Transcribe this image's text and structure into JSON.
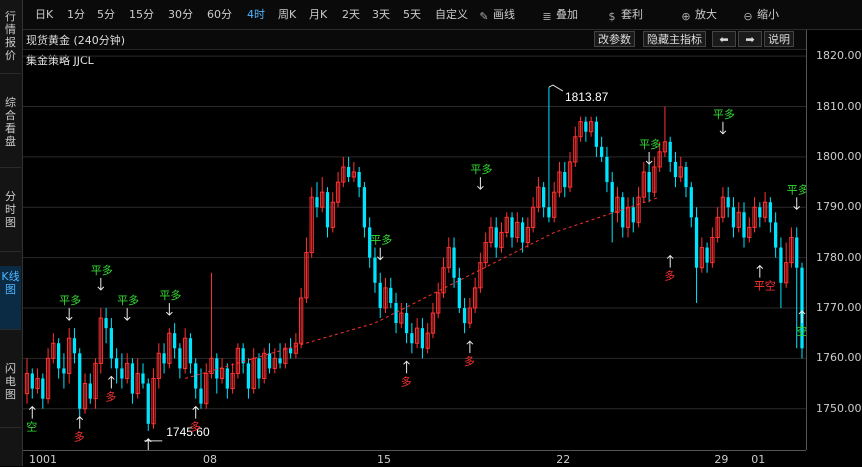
{
  "left_tabs": [
    {
      "label": "行情报价",
      "active": false
    },
    {
      "label": "综合看盘",
      "active": false
    },
    {
      "label": "分时图",
      "active": false
    },
    {
      "label": "K线图",
      "active": true
    },
    {
      "label": "闪电图",
      "active": false
    }
  ],
  "toolbar": {
    "periods": [
      "日K",
      "1分",
      "5分",
      "15分",
      "30分",
      "60分",
      "4时",
      "周K",
      "月K",
      "2天",
      "3天",
      "5天",
      "自定义"
    ],
    "active_period": "4时",
    "tools": [
      {
        "label": "画线",
        "icon": "pencil-icon"
      },
      {
        "label": "叠加",
        "icon": "stack-icon"
      },
      {
        "label": "套利",
        "icon": "money-bag-icon"
      },
      {
        "label": "放大",
        "icon": "zoom-in-icon"
      },
      {
        "label": "缩小",
        "icon": "zoom-out-icon"
      }
    ]
  },
  "chart_header": {
    "title": "现货黄金 (240分钟)",
    "params_button": "改参数",
    "hide_indicator_button": "隐藏主指标",
    "left_arrow": "⬅",
    "right_arrow": "➡",
    "explain_button": "说明"
  },
  "strategy_label": "集金策略 JJCL",
  "price_axis": [
    "1820.00",
    "1810.00",
    "1800.00",
    "1790.00",
    "1780.00",
    "1770.00",
    "1760.00",
    "1750.00"
  ],
  "date_axis": [
    "1001",
    "08",
    "15",
    "22",
    "29",
    "01"
  ],
  "annotations": {
    "high": "1813.87",
    "low": "1745.60"
  },
  "signals": {
    "flat_long": "平多",
    "long": "多",
    "short": "空",
    "flat_short": "平空"
  },
  "colors": {
    "up": "#ff3232",
    "down": "#00e5ff",
    "flat_long": "#33dd33",
    "long_short": "#ff3232",
    "background": "#000000"
  },
  "chart_data": {
    "type": "candlestick",
    "symbol": "现货黄金",
    "period": "240分钟",
    "ylim": [
      1742,
      1825
    ],
    "high": 1813.87,
    "low": 1745.6,
    "candles": [
      [
        1753,
        1757,
        1760,
        1751
      ],
      [
        1757,
        1754,
        1758,
        1752
      ],
      [
        1754,
        1756,
        1758,
        1753
      ],
      [
        1756,
        1752,
        1757,
        1750
      ],
      [
        1752,
        1760,
        1762,
        1751
      ],
      [
        1760,
        1763,
        1765,
        1759
      ],
      [
        1763,
        1758,
        1764,
        1756
      ],
      [
        1758,
        1757,
        1761,
        1754
      ],
      [
        1757,
        1764,
        1766,
        1755
      ],
      [
        1764,
        1761,
        1766,
        1759
      ],
      [
        1761,
        1750,
        1762,
        1748
      ],
      [
        1750,
        1755,
        1757,
        1749
      ],
      [
        1755,
        1752,
        1757,
        1751
      ],
      [
        1752,
        1759,
        1760,
        1750
      ],
      [
        1759,
        1768,
        1770,
        1757
      ],
      [
        1768,
        1766,
        1770,
        1763
      ],
      [
        1766,
        1760,
        1768,
        1758
      ],
      [
        1760,
        1758,
        1762,
        1755
      ],
      [
        1758,
        1756,
        1761,
        1754
      ],
      [
        1756,
        1759,
        1761,
        1755
      ],
      [
        1759,
        1753,
        1760,
        1751
      ],
      [
        1753,
        1757,
        1760,
        1752
      ],
      [
        1757,
        1755,
        1759,
        1754
      ],
      [
        1755,
        1747,
        1756,
        1745.6
      ],
      [
        1747,
        1756,
        1758,
        1746
      ],
      [
        1756,
        1761,
        1763,
        1754
      ],
      [
        1761,
        1759,
        1763,
        1757
      ],
      [
        1759,
        1765,
        1766,
        1758
      ],
      [
        1765,
        1762,
        1767,
        1760
      ],
      [
        1762,
        1758,
        1763,
        1756
      ],
      [
        1758,
        1764,
        1766,
        1757
      ],
      [
        1764,
        1759,
        1765,
        1757
      ],
      [
        1759,
        1754,
        1760,
        1752
      ],
      [
        1754,
        1751,
        1758,
        1750
      ],
      [
        1751,
        1757,
        1759,
        1750
      ],
      [
        1757,
        1760,
        1777,
        1756
      ],
      [
        1760,
        1756,
        1761,
        1753
      ],
      [
        1756,
        1758,
        1760,
        1755
      ],
      [
        1758,
        1754,
        1759,
        1752
      ],
      [
        1754,
        1757,
        1759,
        1753
      ],
      [
        1757,
        1762,
        1763,
        1756
      ],
      [
        1762,
        1759,
        1763,
        1757
      ],
      [
        1759,
        1754,
        1760,
        1752
      ],
      [
        1754,
        1760,
        1762,
        1753
      ],
      [
        1760,
        1756,
        1761,
        1754
      ],
      [
        1756,
        1761,
        1762,
        1755
      ],
      [
        1761,
        1758,
        1763,
        1757
      ],
      [
        1758,
        1760,
        1762,
        1757
      ],
      [
        1760,
        1759,
        1763,
        1758
      ],
      [
        1759,
        1762,
        1763,
        1758
      ],
      [
        1762,
        1761,
        1764,
        1760
      ],
      [
        1761,
        1763,
        1765,
        1760
      ],
      [
        1763,
        1772,
        1774,
        1762
      ],
      [
        1772,
        1781,
        1784,
        1771
      ],
      [
        1781,
        1792,
        1794,
        1780
      ],
      [
        1792,
        1790,
        1795,
        1788
      ],
      [
        1790,
        1793,
        1796,
        1789
      ],
      [
        1793,
        1786,
        1794,
        1784
      ],
      [
        1786,
        1791,
        1793,
        1785
      ],
      [
        1791,
        1795,
        1797,
        1790
      ],
      [
        1795,
        1798,
        1800,
        1794
      ],
      [
        1798,
        1796,
        1800,
        1795
      ],
      [
        1796,
        1797,
        1799,
        1795
      ],
      [
        1797,
        1794,
        1798,
        1792
      ],
      [
        1794,
        1786,
        1795,
        1784
      ],
      [
        1786,
        1780,
        1788,
        1778
      ],
      [
        1780,
        1775,
        1782,
        1773
      ],
      [
        1775,
        1770,
        1777,
        1768
      ],
      [
        1770,
        1774,
        1776,
        1769
      ],
      [
        1774,
        1771,
        1776,
        1770
      ],
      [
        1771,
        1767,
        1773,
        1765
      ],
      [
        1767,
        1769,
        1771,
        1766
      ],
      [
        1769,
        1765,
        1771,
        1763
      ],
      [
        1765,
        1763,
        1767,
        1761
      ],
      [
        1763,
        1766,
        1768,
        1762
      ],
      [
        1766,
        1762,
        1768,
        1760
      ],
      [
        1762,
        1765,
        1767,
        1761
      ],
      [
        1765,
        1769,
        1771,
        1764
      ],
      [
        1769,
        1773,
        1775,
        1768
      ],
      [
        1773,
        1778,
        1780,
        1772
      ],
      [
        1778,
        1782,
        1784,
        1777
      ],
      [
        1782,
        1776,
        1784,
        1774
      ],
      [
        1776,
        1770,
        1778,
        1769
      ],
      [
        1770,
        1767,
        1772,
        1765
      ],
      [
        1767,
        1770,
        1772,
        1766
      ],
      [
        1770,
        1774,
        1776,
        1769
      ],
      [
        1774,
        1779,
        1781,
        1773
      ],
      [
        1779,
        1783,
        1785,
        1778
      ],
      [
        1783,
        1786,
        1788,
        1782
      ],
      [
        1786,
        1782,
        1788,
        1780
      ],
      [
        1782,
        1785,
        1787,
        1781
      ],
      [
        1785,
        1788,
        1789,
        1784
      ],
      [
        1788,
        1784,
        1789,
        1782
      ],
      [
        1784,
        1787,
        1789,
        1783
      ],
      [
        1787,
        1783,
        1788,
        1781
      ],
      [
        1783,
        1786,
        1788,
        1782
      ],
      [
        1786,
        1790,
        1792,
        1785
      ],
      [
        1790,
        1794,
        1796,
        1789
      ],
      [
        1794,
        1790,
        1795,
        1788
      ],
      [
        1790,
        1788,
        1813.87,
        1787
      ],
      [
        1788,
        1793,
        1795,
        1787
      ],
      [
        1793,
        1797,
        1799,
        1792
      ],
      [
        1797,
        1794,
        1799,
        1792
      ],
      [
        1794,
        1799,
        1801,
        1793
      ],
      [
        1799,
        1804,
        1806,
        1798
      ],
      [
        1804,
        1807,
        1808,
        1803
      ],
      [
        1807,
        1805,
        1808,
        1803
      ],
      [
        1805,
        1807,
        1808,
        1804
      ],
      [
        1807,
        1802,
        1808,
        1800
      ],
      [
        1802,
        1800,
        1804,
        1799
      ],
      [
        1800,
        1795,
        1802,
        1793
      ],
      [
        1795,
        1789,
        1797,
        1783
      ],
      [
        1789,
        1792,
        1794,
        1787
      ],
      [
        1792,
        1786,
        1793,
        1784
      ],
      [
        1786,
        1790,
        1792,
        1784
      ],
      [
        1790,
        1787,
        1792,
        1785
      ],
      [
        1787,
        1792,
        1794,
        1786
      ],
      [
        1792,
        1797,
        1799,
        1791
      ],
      [
        1797,
        1793,
        1799,
        1791
      ],
      [
        1793,
        1798,
        1800,
        1792
      ],
      [
        1798,
        1801,
        1803,
        1797
      ],
      [
        1801,
        1803,
        1810,
        1800
      ],
      [
        1803,
        1799,
        1804,
        1797
      ],
      [
        1799,
        1796,
        1801,
        1794
      ],
      [
        1796,
        1798,
        1800,
        1795
      ],
      [
        1798,
        1794,
        1799,
        1792
      ],
      [
        1794,
        1788,
        1795,
        1786
      ],
      [
        1788,
        1778,
        1790,
        1771
      ],
      [
        1778,
        1782,
        1784,
        1777
      ],
      [
        1782,
        1779,
        1783,
        1777
      ],
      [
        1779,
        1784,
        1786,
        1778
      ],
      [
        1784,
        1788,
        1790,
        1783
      ],
      [
        1788,
        1792,
        1794,
        1787
      ],
      [
        1792,
        1790,
        1794,
        1788
      ],
      [
        1790,
        1786,
        1792,
        1784
      ],
      [
        1786,
        1789,
        1791,
        1785
      ],
      [
        1789,
        1784,
        1791,
        1782
      ],
      [
        1784,
        1786,
        1788,
        1783
      ],
      [
        1786,
        1790,
        1792,
        1785
      ],
      [
        1790,
        1788,
        1791,
        1786
      ],
      [
        1788,
        1791,
        1793,
        1787
      ],
      [
        1791,
        1787,
        1792,
        1785
      ],
      [
        1787,
        1782,
        1789,
        1780
      ],
      [
        1782,
        1775,
        1784,
        1770
      ],
      [
        1775,
        1779,
        1783,
        1774
      ],
      [
        1779,
        1784,
        1786,
        1778
      ],
      [
        1784,
        1778,
        1786,
        1762
      ],
      [
        1778,
        1762,
        1779,
        1760
      ]
    ]
  }
}
